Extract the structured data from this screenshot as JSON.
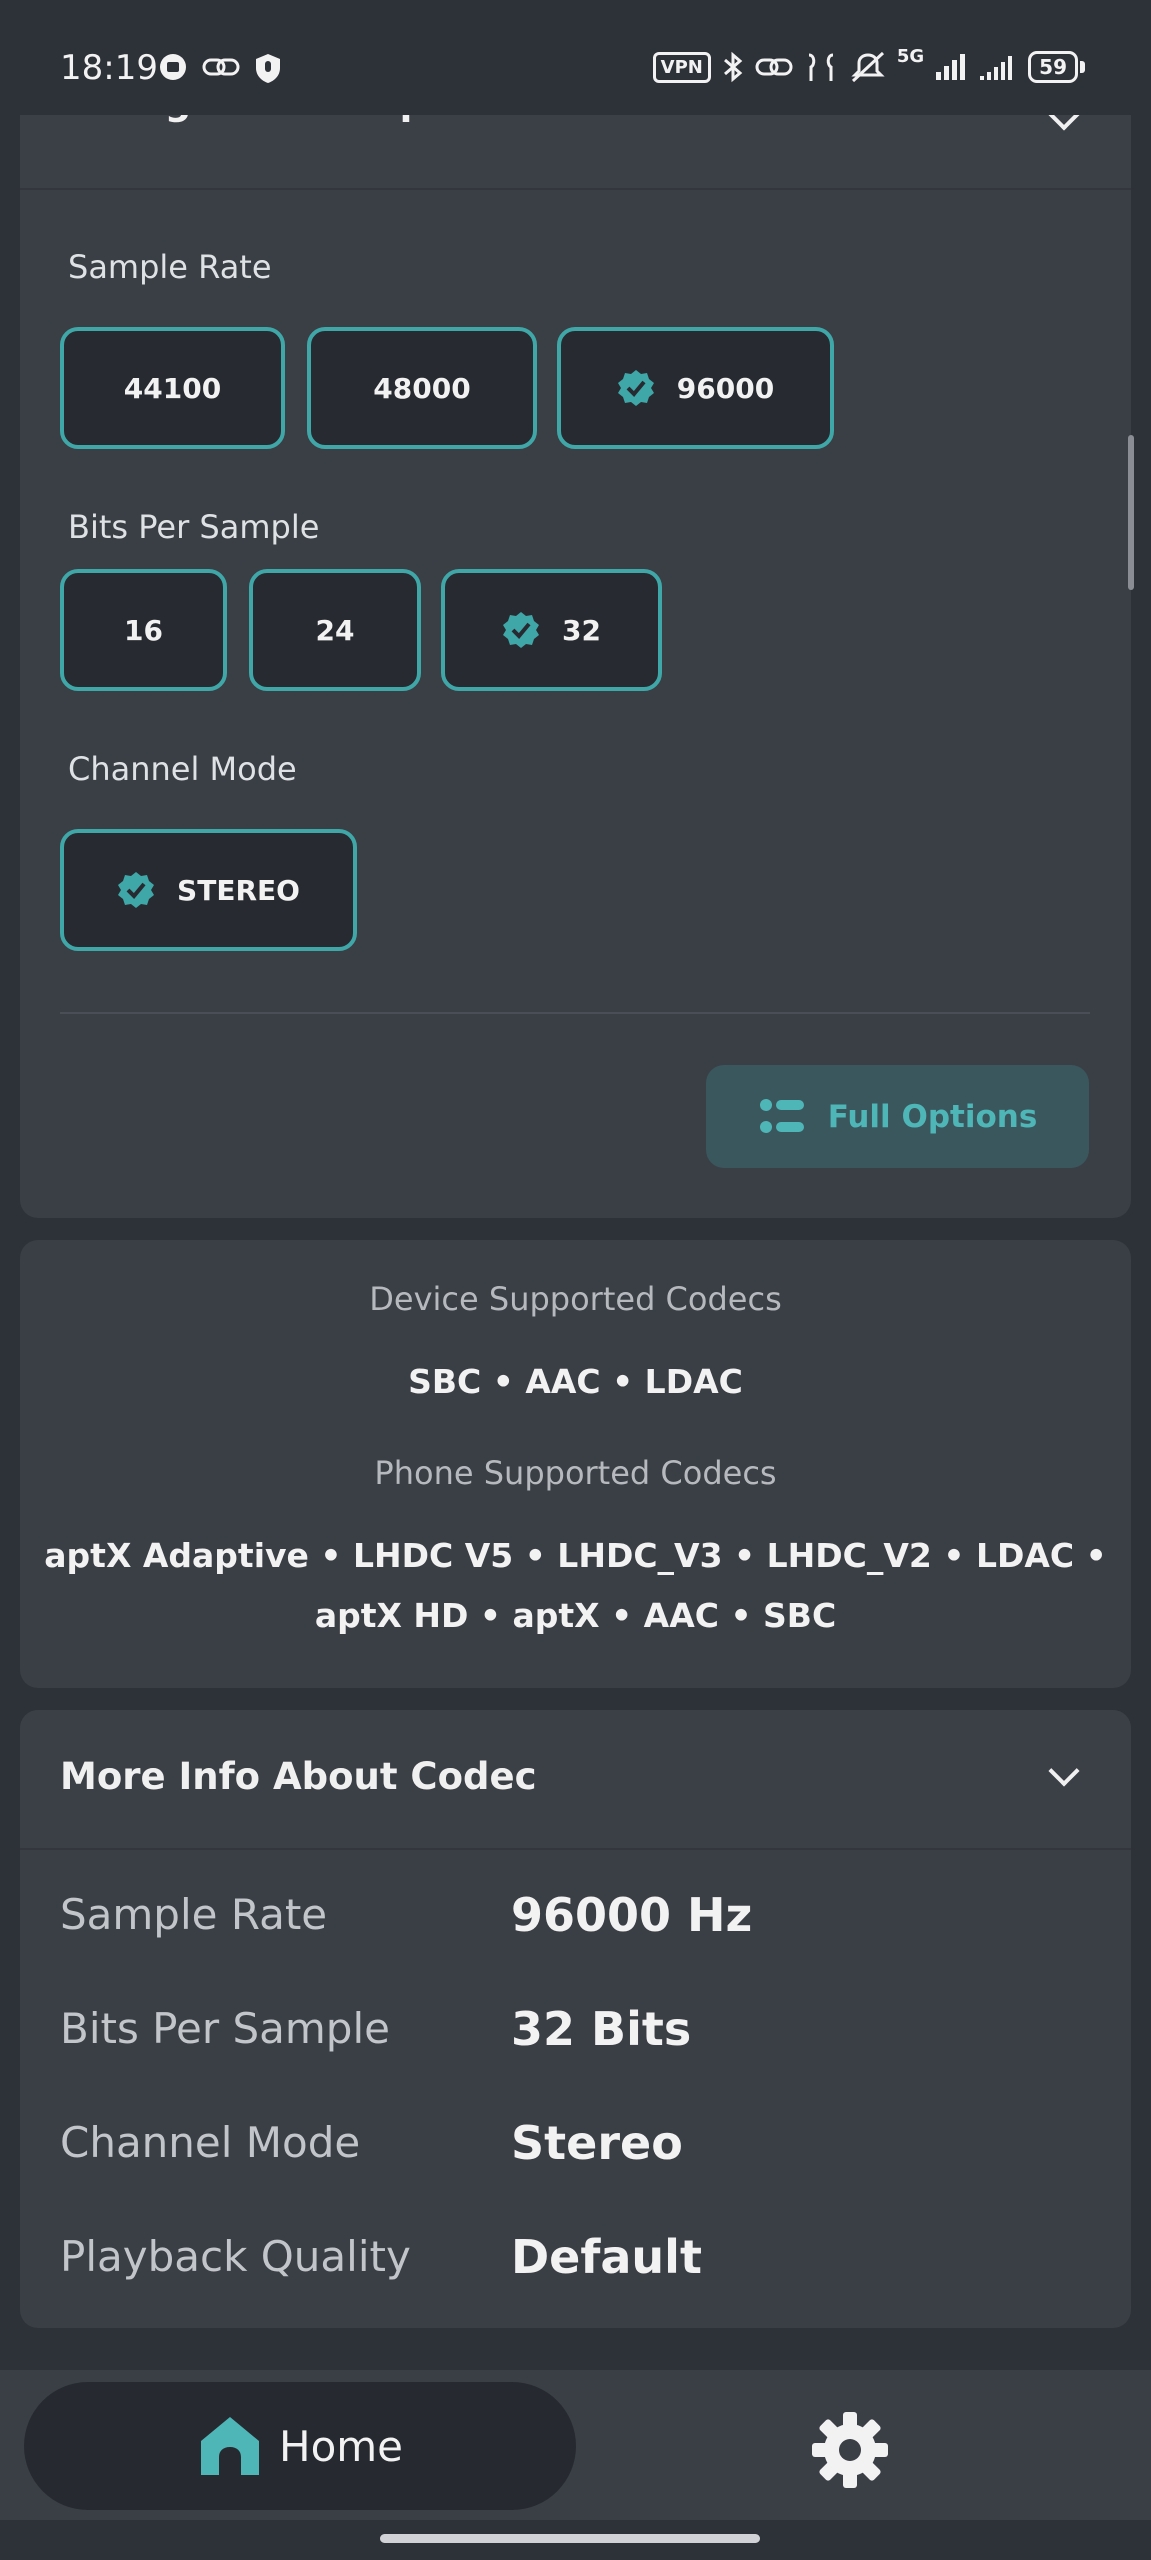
{
  "status_bar": {
    "time": "18:19",
    "vpn_label": "VPN",
    "network_label": "5G",
    "battery": "59",
    "icons_left": [
      "notification-icon",
      "link-icon",
      "shield-mic-icon"
    ],
    "icons_right": [
      "vpn-icon",
      "bluetooth-icon",
      "link-icon",
      "earbuds-icon",
      "mute-icon",
      "signal-icon",
      "signal-icon",
      "battery-icon"
    ]
  },
  "codec_options": {
    "title": "Change Codec Options",
    "sample_rate": {
      "label": "Sample Rate",
      "options": [
        "44100",
        "48000",
        "96000"
      ],
      "selected": "96000"
    },
    "bits_per_sample": {
      "label": "Bits Per Sample",
      "options": [
        "16",
        "24",
        "32"
      ],
      "selected": "32"
    },
    "channel_mode": {
      "label": "Channel Mode",
      "options": [
        "STEREO"
      ],
      "selected": "STEREO"
    },
    "full_options_label": "Full Options"
  },
  "supported": {
    "device_label": "Device Supported Codecs",
    "device_codecs": "SBC • AAC • LDAC",
    "phone_label": "Phone Supported Codecs",
    "phone_codecs_line1": "aptX Adaptive • LHDC V5 • LHDC_V3 • LHDC_V2 • LDAC •",
    "phone_codecs_line2": "aptX HD • aptX • AAC • SBC"
  },
  "more_info": {
    "title": "More Info About Codec",
    "rows": [
      {
        "key": "Sample Rate",
        "value": "96000 Hz"
      },
      {
        "key": "Bits Per Sample",
        "value": "32 Bits"
      },
      {
        "key": "Channel Mode",
        "value": "Stereo"
      },
      {
        "key": "Playback Quality",
        "value": "Default"
      }
    ]
  },
  "nav": {
    "home_label": "Home"
  },
  "colors": {
    "accent": "#3fa7a8",
    "card": "#3a3e45",
    "background": "#2d3138"
  }
}
